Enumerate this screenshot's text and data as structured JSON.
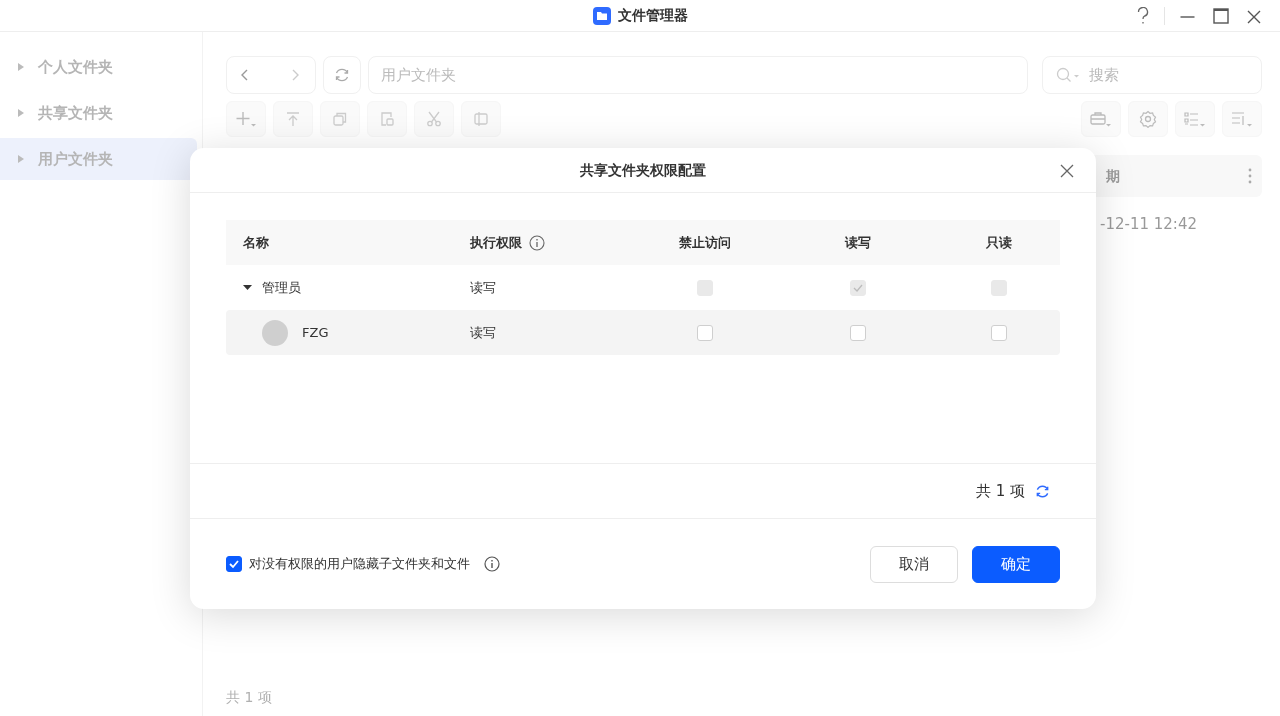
{
  "window": {
    "title": "文件管理器"
  },
  "sidebar": {
    "items": [
      {
        "label": "个人文件夹",
        "selected": false
      },
      {
        "label": "共享文件夹",
        "selected": false
      },
      {
        "label": "用户文件夹",
        "selected": true
      }
    ]
  },
  "path_field": {
    "value": "用户文件夹"
  },
  "search": {
    "placeholder": "搜索"
  },
  "file_list": {
    "columns": [
      "期"
    ],
    "rows": [
      [
        "-12-11 12:42"
      ]
    ],
    "footer": "共 1 项"
  },
  "dialog": {
    "title": "共享文件夹权限配置",
    "table": {
      "columns": [
        {
          "label": "名称",
          "info": false
        },
        {
          "label": "执行权限",
          "info": true
        },
        {
          "label": "禁止访问",
          "info": false
        },
        {
          "label": "读写",
          "info": false
        },
        {
          "label": "只读",
          "info": false
        }
      ],
      "rows": [
        {
          "kind": "group",
          "name": "管理员",
          "expanded": true,
          "permission": "读写",
          "disabled": true,
          "options": [
            {
              "checked": false
            },
            {
              "checked": true
            },
            {
              "checked": false
            }
          ]
        },
        {
          "kind": "user",
          "name": "FZG",
          "permission": "读写",
          "disabled": false,
          "options": [
            {
              "checked": false
            },
            {
              "checked": false
            },
            {
              "checked": false
            }
          ]
        }
      ]
    },
    "count": "共 1 项",
    "hide_option": {
      "label": "对没有权限的用户隐藏子文件夹和文件",
      "checked": true
    },
    "buttons": [
      {
        "label": "取消",
        "kind": "secondary"
      },
      {
        "label": "确定",
        "kind": "primary"
      }
    ]
  }
}
